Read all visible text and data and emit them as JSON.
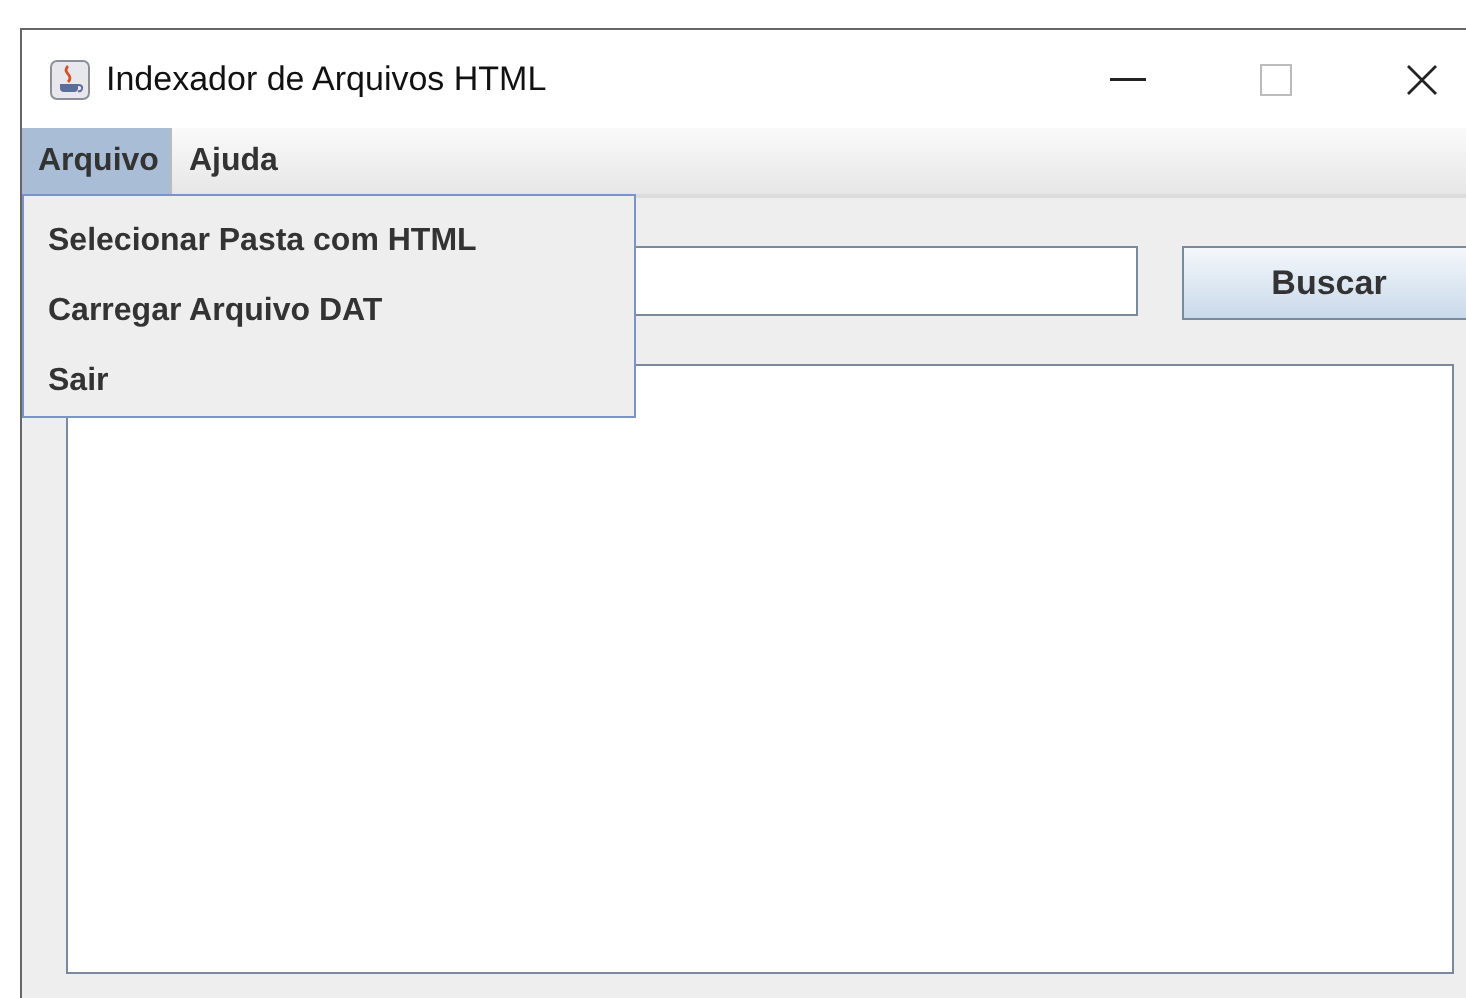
{
  "window": {
    "title": "Indexador de Arquivos HTML"
  },
  "menu_bar": [
    {
      "label": "Arquivo",
      "selected": true,
      "open": true,
      "items": [
        "Selecionar Pasta com HTML",
        "Carregar Arquivo DAT",
        "Sair"
      ]
    },
    {
      "label": "Ajuda",
      "selected": false
    }
  ],
  "search": {
    "button": "Buscar"
  }
}
